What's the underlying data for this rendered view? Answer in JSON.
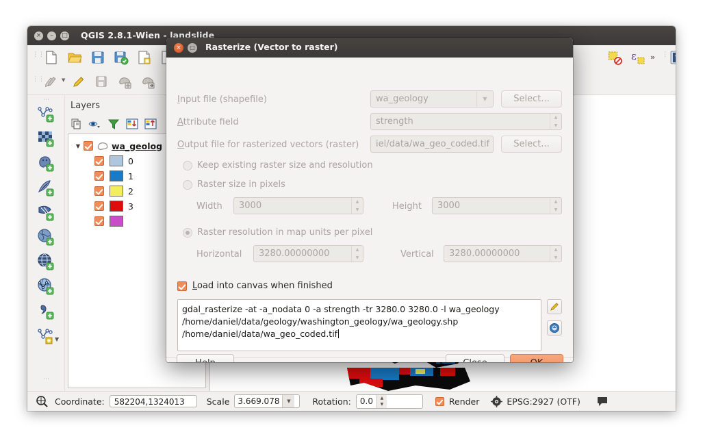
{
  "main_window": {
    "title": "QGIS 2.8.1-Wien - landslide",
    "window_buttons": {
      "close": "×",
      "minimize": "–",
      "maximize": "□"
    },
    "toolbar_row1": [
      {
        "name": "new-project-icon",
        "label": "New Project"
      },
      {
        "name": "open-project-icon",
        "label": "Open Project"
      },
      {
        "name": "save-project-icon",
        "label": "Save Project"
      },
      {
        "name": "save-project-as-icon",
        "label": "Save Project As"
      },
      {
        "name": "new-print-composer-icon",
        "label": "New Print Composer"
      },
      {
        "name": "composer-manager-icon",
        "label": "Composer Manager"
      }
    ],
    "toolbar_row2": [
      {
        "name": "pencils-icon",
        "label": "Current Edits"
      },
      {
        "name": "toggle-editing-icon",
        "label": "Toggle Editing"
      },
      {
        "name": "save-layer-edits-icon",
        "label": "Save Layer Edits"
      },
      {
        "name": "add-feature-icon",
        "label": "Add Feature"
      },
      {
        "name": "move-feature-icon",
        "label": "Move Feature"
      }
    ],
    "toolbar_right": [
      {
        "name": "deselect-features-icon",
        "label": "Deselect Features from All Layers"
      },
      {
        "name": "select-by-expression-icon",
        "label": "Select Features using an Expression"
      },
      {
        "name": "toolbar-overflow-chevron",
        "label": "»"
      },
      {
        "name": "help-icon",
        "label": "Help"
      },
      {
        "name": "toolbar-overflow-chevron-2",
        "label": "»"
      }
    ],
    "left_toolbar": [
      {
        "name": "add-vector-layer-icon",
        "label": "Add Vector Layer"
      },
      {
        "name": "add-raster-layer-icon",
        "label": "Add Raster Layer"
      },
      {
        "name": "add-postgis-layer-icon",
        "label": "Add PostGIS Layers"
      },
      {
        "name": "add-spatialite-layer-icon",
        "label": "Add SpatiaLite Layer"
      },
      {
        "name": "add-mssql-layer-icon",
        "label": "Add MSSQL Spatial Layer"
      },
      {
        "name": "add-wms-layer-icon",
        "label": "Add WMS/WMTS Layer"
      },
      {
        "name": "add-wcs-layer-icon",
        "label": "Add WCS Layer"
      },
      {
        "name": "add-wfs-layer-icon",
        "label": "Add WFS Layer"
      },
      {
        "name": "add-delimited-text-layer-icon",
        "label": "Add Delimited Text Layer"
      },
      {
        "name": "new-shapefile-layer-icon",
        "label": "New Shapefile Layer"
      }
    ]
  },
  "layers_panel": {
    "title": "Layers",
    "toolbar": [
      {
        "name": "layer-styling-icon",
        "label": "Manage Layer Styling"
      },
      {
        "name": "filter-legend-visible-icon",
        "label": "Filter Legend By Map Content"
      },
      {
        "name": "filter-legend-icon",
        "label": "Filter Legend By Expression"
      },
      {
        "name": "expand-all-icon",
        "label": "Expand All"
      },
      {
        "name": "collapse-all-icon",
        "label": "Collapse All"
      }
    ],
    "layer": {
      "name": "wa_geolog",
      "checked": true,
      "expanded": true
    },
    "symbols": [
      {
        "label": "0",
        "color": "#aec7de"
      },
      {
        "label": "1",
        "color": "#1a7ac4"
      },
      {
        "label": "2",
        "color": "#f3ee5e"
      },
      {
        "label": "3",
        "color": "#e00c0c"
      },
      {
        "label": "",
        "color": "#c martin"
      }
    ],
    "symbols_fixed": [
      {
        "label": "0",
        "color": "#aec7de",
        "checked": true
      },
      {
        "label": "1",
        "color": "#1a7ac4",
        "checked": true
      },
      {
        "label": "2",
        "color": "#f3ee5e",
        "checked": true
      },
      {
        "label": "3",
        "color": "#e00c0c",
        "checked": true
      },
      {
        "label": "",
        "color": "#c84ec8",
        "checked": true
      }
    ]
  },
  "status_bar": {
    "locate_icon": "locate-icon",
    "coordinate_label": "Coordinate:",
    "coordinate_value": "582204,1324013",
    "scale_label": "Scale",
    "scale_value": "3.669.078",
    "rotation_label": "Rotation:",
    "rotation_value": "0.0",
    "render_label": "Render",
    "render_checked": true,
    "crs_label": "EPSG:2927 (OTF)",
    "crs_icon": "crs-globe-icon",
    "messages_icon": "messages-bubble-icon"
  },
  "dialog": {
    "title": "Rasterize (Vector to raster)",
    "close_glyph": "×",
    "max_glyph": "□",
    "fields": {
      "input_file": {
        "label_pre": "I",
        "label_post": "nput file (shapefile)",
        "value": "wa_geology",
        "button": "Select..."
      },
      "attribute_field": {
        "label_pre": "A",
        "label_post": "ttribute field",
        "value": "strength"
      },
      "output_file": {
        "label_pre": "O",
        "label_post": "utput file for rasterized vectors (raster)",
        "value": "iel/data/wa_geo_coded.tif",
        "button": "Select..."
      }
    },
    "radios": [
      {
        "label": "Keep existing raster size and resolution",
        "selected": false
      },
      {
        "label": "Raster size in pixels",
        "selected": false
      },
      {
        "label": "Raster resolution in map units per pixel",
        "selected": true
      }
    ],
    "size_inputs": {
      "width_label": "Width",
      "width_value": "3000",
      "height_label": "Height",
      "height_value": "3000"
    },
    "resolution_inputs": {
      "horizontal_label": "Horizontal",
      "horizontal_value": "3280.00000000",
      "vertical_label": "Vertical",
      "vertical_value": "3280.00000000"
    },
    "load_canvas": {
      "label_pre": "L",
      "label_post": "oad into canvas when finished",
      "checked": true
    },
    "command_lines": [
      "gdal_rasterize -at -a_nodata 0 -a strength -tr 3280.0 3280.0 -l wa_geology",
      "/home/daniel/data/geology/washington_geology/wa_geology.shp",
      "/home/daniel/data/wa_geo_coded.tif"
    ],
    "side_buttons": [
      {
        "name": "edit-command-icon",
        "label": "Edit command"
      },
      {
        "name": "reset-command-icon",
        "label": "Reset command"
      }
    ],
    "buttons": {
      "help": "Help",
      "close_pre": "C",
      "close_post": "lose",
      "ok_pre": "O",
      "ok_post": "K"
    }
  },
  "map": {
    "raster_colors": {
      "class_0": "#aec7de",
      "class_1": "#1a7ac4",
      "class_2": "#f3ee5e",
      "class_3": "#e00c0c",
      "nodata": "#0b0b0b"
    },
    "background": "#ffffff"
  },
  "theme": {
    "accent_orange": "#f28b55",
    "titlebar_dark": "#3f3c3a",
    "panel_bg": "#f2f1f0",
    "dialog_bg": "#f4f3f1",
    "disabled_text": "#a9a5a1"
  }
}
